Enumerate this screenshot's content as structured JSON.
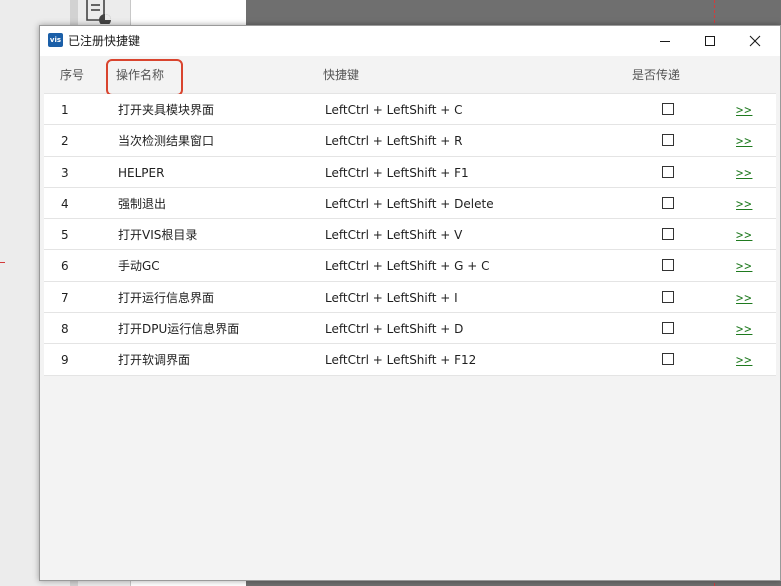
{
  "window": {
    "title": "已注册快捷键",
    "app_icon_text": "vis"
  },
  "table": {
    "headers": {
      "seq": "序号",
      "name": "操作名称",
      "shortcut": "快捷键",
      "pass_through": "是否传递"
    },
    "rows": [
      {
        "seq": "1",
        "name": "打开夹具模块界面",
        "shortcut": "LeftCtrl + LeftShift + C",
        "pass": false,
        "more": ">>"
      },
      {
        "seq": "2",
        "name": "当次检测结果窗口",
        "shortcut": "LeftCtrl + LeftShift + R",
        "pass": false,
        "more": ">>"
      },
      {
        "seq": "3",
        "name": "HELPER",
        "shortcut": "LeftCtrl + LeftShift + F1",
        "pass": false,
        "more": ">>"
      },
      {
        "seq": "4",
        "name": "强制退出",
        "shortcut": "LeftCtrl + LeftShift + Delete",
        "pass": false,
        "more": ">>"
      },
      {
        "seq": "5",
        "name": "打开VIS根目录",
        "shortcut": "LeftCtrl + LeftShift + V",
        "pass": false,
        "more": ">>"
      },
      {
        "seq": "6",
        "name": "手动GC",
        "shortcut": "LeftCtrl + LeftShift + G + C",
        "pass": false,
        "more": ">>"
      },
      {
        "seq": "7",
        "name": "打开运行信息界面",
        "shortcut": "LeftCtrl + LeftShift + I",
        "pass": false,
        "more": ">>"
      },
      {
        "seq": "8",
        "name": "打开DPU运行信息界面",
        "shortcut": "LeftCtrl + LeftShift + D",
        "pass": false,
        "more": ">>"
      },
      {
        "seq": "9",
        "name": "打开软调界面",
        "shortcut": "LeftCtrl + LeftShift + F12",
        "pass": false,
        "more": ">>"
      }
    ]
  },
  "colors": {
    "link": "#1f7a1f",
    "highlight": "#d9442e",
    "app_icon": "#1b5fa8"
  }
}
